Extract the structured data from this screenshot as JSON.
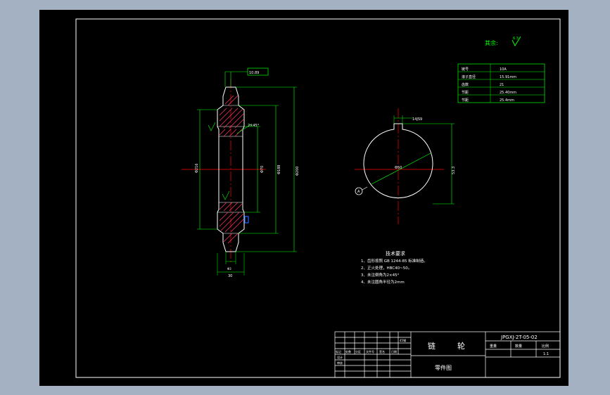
{
  "roughness": {
    "label": "其余:",
    "value": "6.3"
  },
  "params_table": [
    {
      "name": "链号",
      "value": "10A"
    },
    {
      "name": "滚子直径",
      "value": "15.91mm"
    },
    {
      "name": "齿数",
      "value": "21"
    },
    {
      "name": "节距",
      "value": "25.40mm"
    },
    {
      "name": "节距",
      "value": "25.4mm"
    }
  ],
  "dims": {
    "flat": "10.89",
    "keyway_width": "14JS9",
    "bore_dia": "Φ50",
    "chamfer": "2×45°",
    "od_left": "Φ216",
    "od_bore": "Φ70",
    "od_mid": "Φ188",
    "od_right": "Φ200",
    "hub_width": "30",
    "small_right": "Φ3",
    "key_depth": "53.3",
    "datum": "A"
  },
  "tech": {
    "title": "技术要求",
    "items": [
      "1、齿形按照 GB 1244-85 标准制造。",
      "2、正火处理，HBC40~50。",
      "3、未注倒角为2×45°",
      "4、未注圆角半径为2mm"
    ]
  },
  "title_block": {
    "drawing_no": "JPGXJ-2T-05-02",
    "part_name_1": "链",
    "part_name_2": "轮",
    "sub_title": "零件图",
    "scale_header": "比例",
    "qty_header": "数量",
    "weight_header": "重量",
    "scale_value": "1:1",
    "material": "45钢",
    "headers": [
      "标记",
      "处数",
      "分区",
      "文件号",
      "签名",
      "日期"
    ],
    "designer": "设计",
    "checker": "审核"
  }
}
